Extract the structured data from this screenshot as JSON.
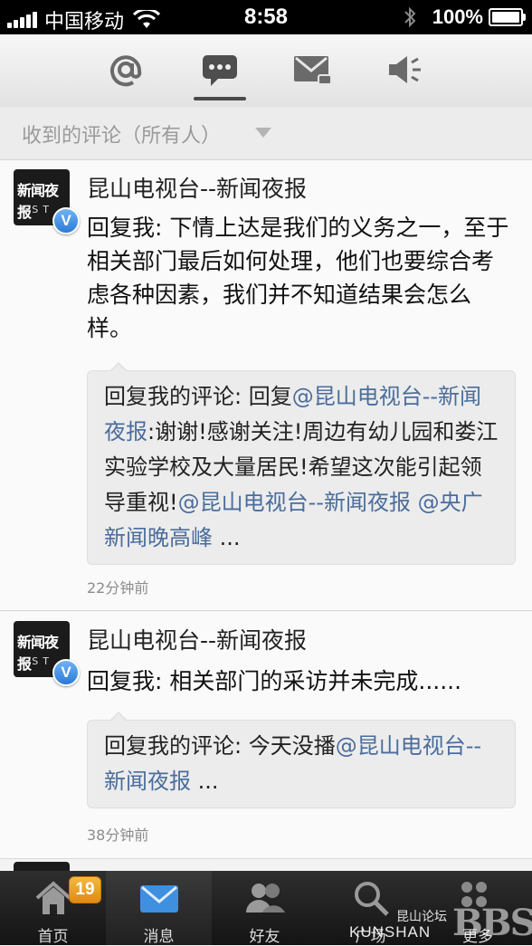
{
  "status_bar": {
    "carrier": "中国移动",
    "time": "8:58",
    "battery": "100%"
  },
  "top_tabs": [
    {
      "icon": "at-sign-icon",
      "active": false
    },
    {
      "icon": "comment-icon",
      "active": true
    },
    {
      "icon": "envelope-icon",
      "active": false
    },
    {
      "icon": "speaker-icon",
      "active": false
    }
  ],
  "filter": {
    "label": "收到的评论（所有人）"
  },
  "comments": [
    {
      "author": "昆山电视台--新闻夜报",
      "avatar_text_top": "新闻夜报",
      "avatar_text_bottom": "KST",
      "verified": "V",
      "body": "回复我: 下情上达是我们的义务之一，至于相关部门最后如何处理，他们也要综合考虑各种因素，我们并不知道结果会怎么样。",
      "quote": {
        "prefix": "回复我的评论: 回复",
        "mention1": "@昆山电视台--新闻夜报",
        "text": ":谢谢!感谢关注!周边有幼儿园和娄江实验学校及大量居民!希望这次能引起领导重视!",
        "mention2": "@昆山电视台--新闻夜报 @央广新闻晚高峰",
        "suffix": " ..."
      },
      "time": "22分钟前"
    },
    {
      "author": "昆山电视台--新闻夜报",
      "avatar_text_top": "新闻夜报",
      "avatar_text_bottom": "KST",
      "verified": "V",
      "body": "回复我: 相关部门的采访并未完成......",
      "quote": {
        "prefix": "回复我的评论: 今天没播",
        "mention1": "@昆山电视台--新闻夜报",
        "suffix": " ..."
      },
      "time": "38分钟前"
    }
  ],
  "bottom_tabs": [
    {
      "label": "首页",
      "icon": "home-icon",
      "badge": "19"
    },
    {
      "label": "消息",
      "icon": "envelope-icon",
      "active": true
    },
    {
      "label": "好友",
      "icon": "friends-icon"
    },
    {
      "label": "广场",
      "icon": "search-icon"
    },
    {
      "label": "更多",
      "icon": "more-icon"
    }
  ],
  "watermark": {
    "site": "昆山论坛",
    "brand": "KUNSHAN",
    "bbs": "BBS"
  }
}
